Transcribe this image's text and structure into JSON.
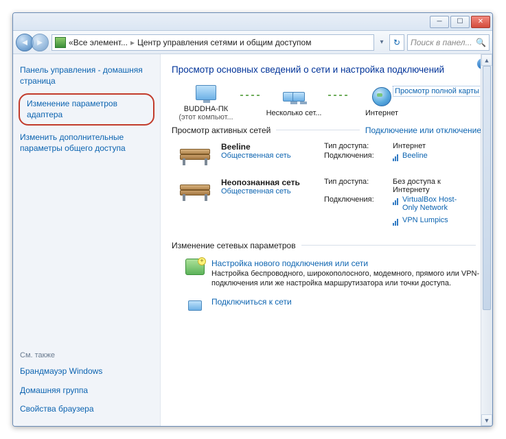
{
  "breadcrumb": {
    "part1": "Все элемент...",
    "part2": "Центр управления сетями и общим доступом"
  },
  "search_placeholder": "Поиск в панел...",
  "sidebar": {
    "home": "Панель управления - домашняя страница",
    "adapter": "Изменение параметров адаптера",
    "sharing": "Изменить дополнительные параметры общего доступа",
    "see_also": "См. также",
    "firewall": "Брандмауэр Windows",
    "homegroup": "Домашняя группа",
    "browser": "Свойства браузера"
  },
  "main": {
    "title": "Просмотр основных сведений о сети и настройка подключений",
    "map_link": "Просмотр полной карты",
    "node1": "BUDDHA-ПК",
    "node1_sub": "(этот компьют...",
    "node2": "Несколько сет...",
    "node3": "Интернет",
    "active_hdr": "Просмотр активных сетей",
    "toggle_link": "Подключение или отключение",
    "net1": {
      "name": "Beeline",
      "type": "Общественная сеть",
      "access_k": "Тип доступа:",
      "access_v": "Интернет",
      "conn_k": "Подключения:",
      "conn_v": "Beeline"
    },
    "net2": {
      "name": "Неопознанная сеть",
      "type": "Общественная сеть",
      "access_k": "Тип доступа:",
      "access_v": "Без доступа к Интернету",
      "conn_k": "Подключения:",
      "conn_v1": "VirtualBox Host-Only Network",
      "conn_v2": "VPN Lumpics"
    },
    "change_hdr": "Изменение сетевых параметров",
    "item1_title": "Настройка нового подключения или сети",
    "item1_desc": "Настройка беспроводного, широкополосного, модемного, прямого или VPN-подключения или же настройка маршрутизатора или точки доступа.",
    "item2_title": "Подключиться к сети"
  }
}
